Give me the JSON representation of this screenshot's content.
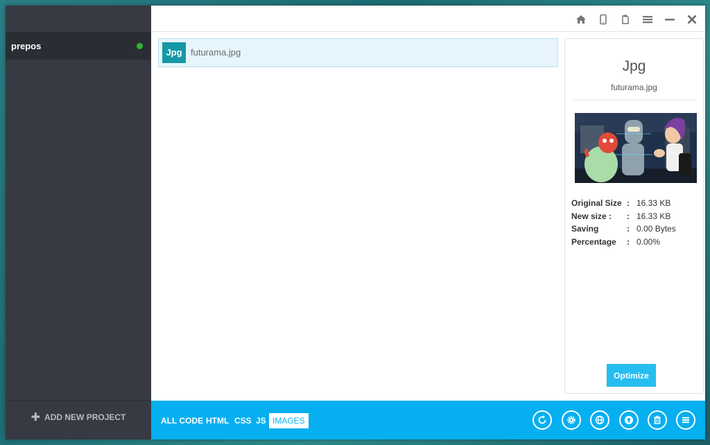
{
  "sidebar": {
    "projects": [
      {
        "name": "prepos",
        "status_color": "#2fb52f"
      }
    ],
    "add_project_label": "ADD NEW PROJECT"
  },
  "topbar": {
    "icons": [
      "home-icon",
      "mobile-icon",
      "clipboard-icon",
      "menu-icon",
      "minimize-icon",
      "close-icon"
    ]
  },
  "files": [
    {
      "badge": "Jpg",
      "name": "futurama.jpg"
    }
  ],
  "details": {
    "type": "Jpg",
    "filename": "futurama.jpg",
    "stats": [
      {
        "label": "Original Size",
        "value": "16.33 KB"
      },
      {
        "label": "New size :",
        "value": "16.33 KB"
      },
      {
        "label": "Saving",
        "value": "0.00 Bytes"
      },
      {
        "label": "Percentage",
        "value": "0.00%"
      }
    ],
    "optimize_label": "Optimize"
  },
  "bottombar": {
    "filters": [
      "ALL CODE",
      "HTML",
      "CSS",
      "JS",
      "IMAGES"
    ],
    "active_filter": "IMAGES",
    "actions": [
      "refresh-icon",
      "settings-icon",
      "globe-icon",
      "upload-icon",
      "trash-icon",
      "list-icon"
    ]
  },
  "colors": {
    "accent": "#06aff0",
    "sidebar": "#373943",
    "badge": "#1697a6",
    "status_dot": "#2fb52f"
  }
}
